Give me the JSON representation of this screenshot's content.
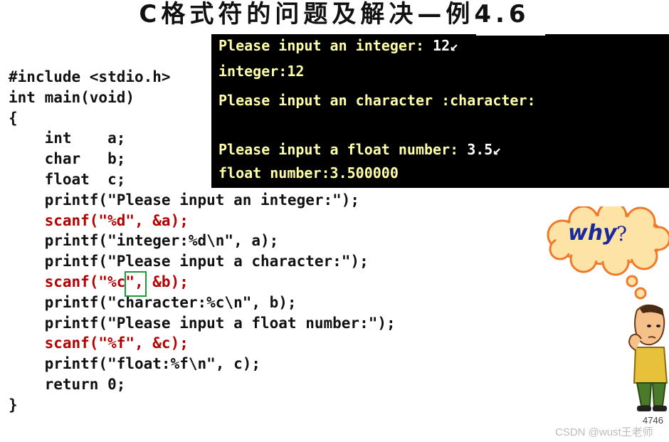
{
  "title": "C格式符的问题及解决—例4.6",
  "code_lines": [
    {
      "text": "#include <stdio.h>",
      "red": false
    },
    {
      "text": "int main(void)",
      "red": false
    },
    {
      "text": "{",
      "red": false
    },
    {
      "text": "    int    a;",
      "red": false
    },
    {
      "text": "    char   b;",
      "red": false
    },
    {
      "text": "    float  c;",
      "red": false
    },
    {
      "text": "    printf(\"Please input an integer:\");",
      "red": false
    },
    {
      "text": "    scanf(\"%d\", &a);",
      "red": true
    },
    {
      "text": "    printf(\"integer:%d\\n\", a);",
      "red": false
    },
    {
      "text": "    printf(\"Please input a character:\");",
      "red": false
    },
    {
      "text": "    scanf(\"%c\", &b);",
      "red": true
    },
    {
      "text": "    printf(\"character:%c\\n\", b);",
      "red": false
    },
    {
      "text": "    printf(\"Please input a float number:\");",
      "red": false
    },
    {
      "text": "    scanf(\"%f\", &c);",
      "red": true
    },
    {
      "text": "    printf(\"float:%f\\n\", c);",
      "red": false
    },
    {
      "text": "    return 0;",
      "red": false
    },
    {
      "text": "}",
      "red": false
    }
  ],
  "terminal": {
    "line1_prompt": "Please input an integer:",
    "line1_input": "12↙",
    "line2": "integer:12",
    "line3_prompt": "Please input an character :",
    "line3_output": "character:",
    "line4_prompt": "Please input a float number:",
    "line4_input": "3.5↙",
    "line5": "float number:3.500000"
  },
  "bubble": {
    "why": "why",
    "question_mark": "?"
  },
  "page_number": "4746",
  "watermark": "CSDN @wust王老师",
  "colors": {
    "code_red": "#b30000",
    "terminal_bg": "#000000",
    "terminal_text": "#ffffa8",
    "highlight_green": "#1a9a3a",
    "why_blue": "#1a2a9a",
    "cloud_fill": "#fde4a6",
    "cloud_stroke": "#f07a2a"
  }
}
